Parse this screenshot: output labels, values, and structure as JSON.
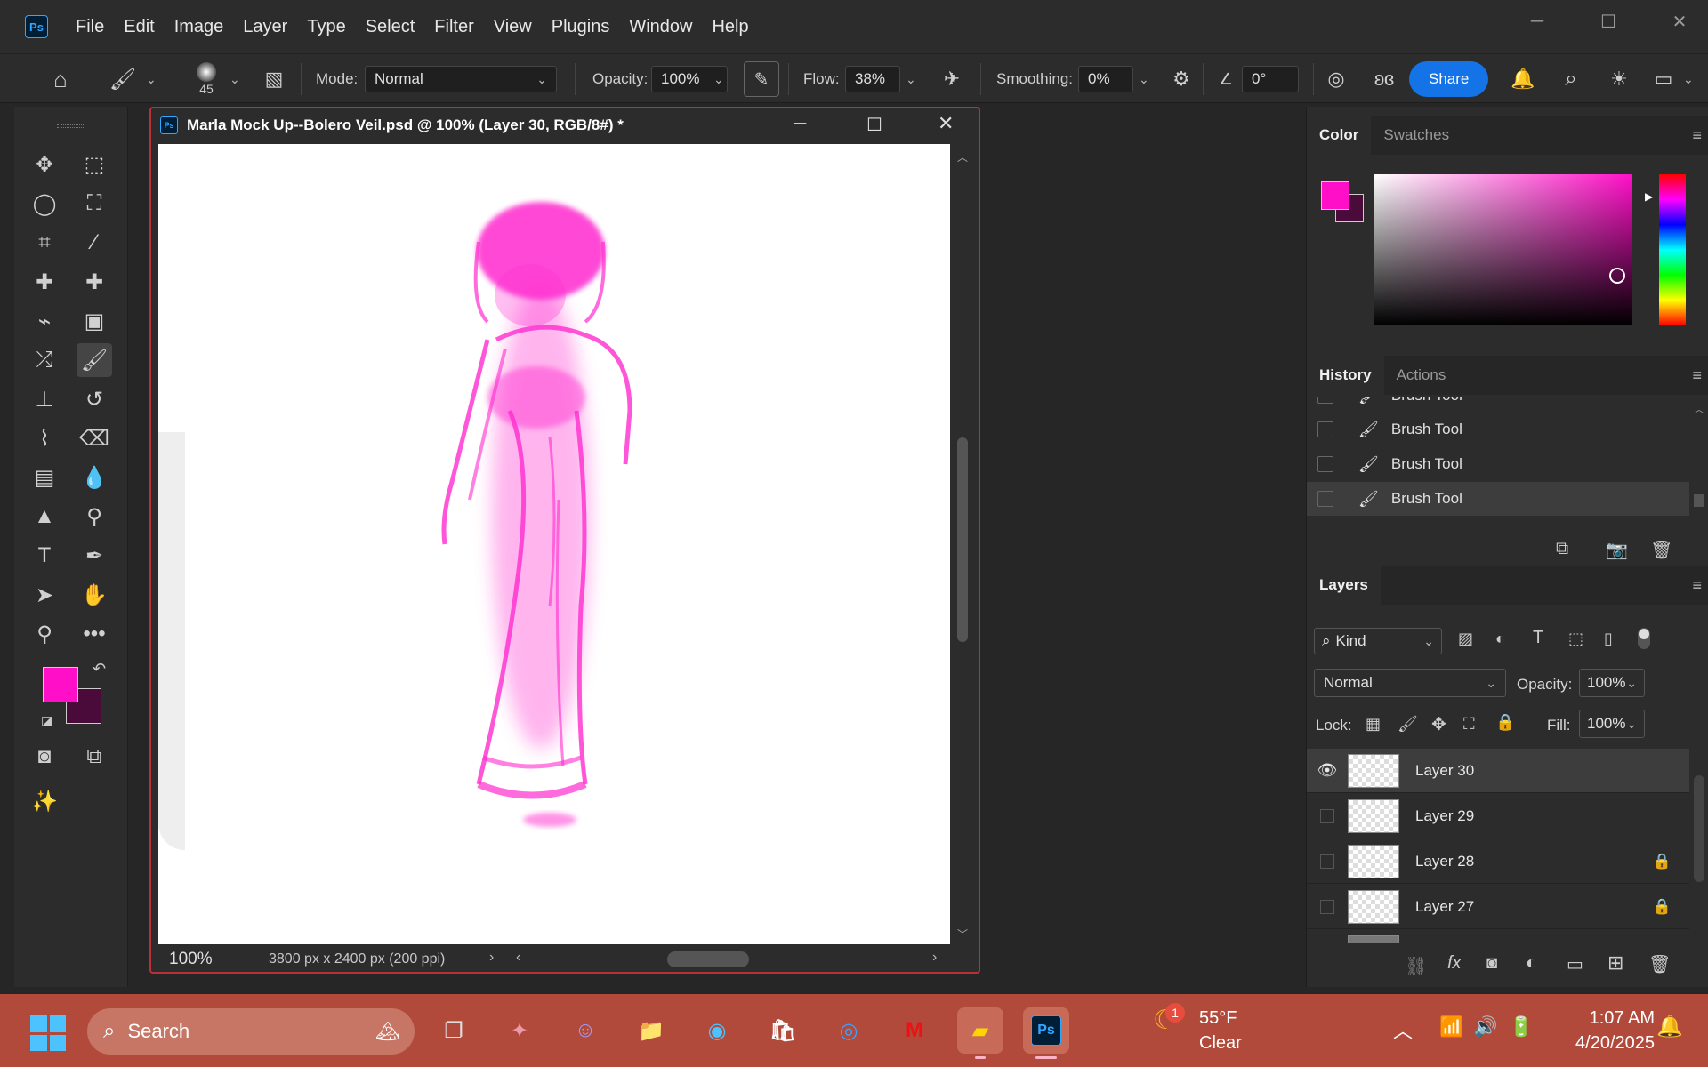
{
  "app": {
    "logo": "Ps",
    "menu": [
      "File",
      "Edit",
      "Image",
      "Layer",
      "Type",
      "Select",
      "Filter",
      "View",
      "Plugins",
      "Window",
      "Help"
    ]
  },
  "options": {
    "brush_size": "45",
    "mode_label": "Mode:",
    "mode_value": "Normal",
    "opacity_label": "Opacity:",
    "opacity_value": "100%",
    "flow_label": "Flow:",
    "flow_value": "38%",
    "smoothing_label": "Smoothing:",
    "smoothing_value": "0%",
    "angle_value": "0°",
    "share_label": "Share"
  },
  "document": {
    "title": "Marla Mock Up--Bolero Veil.psd @ 100% (Layer 30, RGB/8#) *",
    "zoom": "100%",
    "info": "3800 px x 2400 px (200 ppi)"
  },
  "colors": {
    "foreground": "#ff10c8",
    "background": "#4a0a3a",
    "accent": "#1473e6",
    "brush_stroke": "#ff2ccf"
  },
  "color_panel": {
    "tabs": [
      "Color",
      "Swatches"
    ]
  },
  "history_panel": {
    "tabs": [
      "History",
      "Actions"
    ],
    "items": [
      "Brush Tool",
      "Brush Tool",
      "Brush Tool",
      "Brush Tool"
    ]
  },
  "layers_panel": {
    "title": "Layers",
    "filter_label": "Kind",
    "blend_mode": "Normal",
    "opacity_label": "Opacity:",
    "opacity_value": "100%",
    "lock_label": "Lock:",
    "fill_label": "Fill:",
    "fill_value": "100%",
    "layers": [
      {
        "name": "Layer 30",
        "visible": true,
        "locked": false,
        "selected": true
      },
      {
        "name": "Layer 29",
        "visible": false,
        "locked": false,
        "selected": false
      },
      {
        "name": "Layer 28",
        "visible": false,
        "locked": true,
        "selected": false
      },
      {
        "name": "Layer 27",
        "visible": false,
        "locked": true,
        "selected": false
      }
    ]
  },
  "taskbar": {
    "search_placeholder": "Search",
    "weather_temp": "55°F",
    "weather_desc": "Clear",
    "weather_badge": "1",
    "time": "1:07 AM",
    "date": "4/20/2025"
  }
}
